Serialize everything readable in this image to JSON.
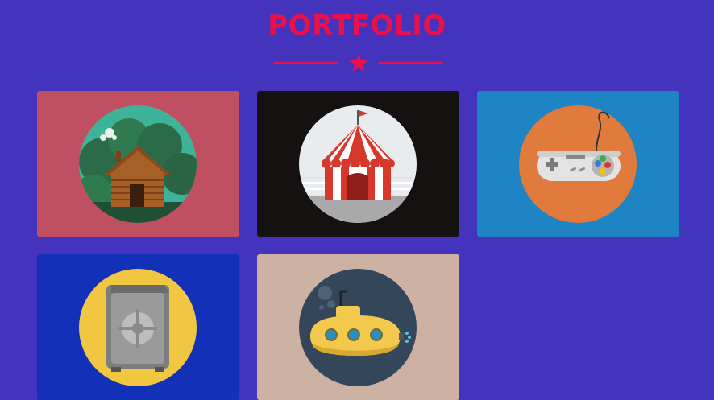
{
  "header": {
    "title": "PORTFOLIO"
  },
  "portfolio": {
    "items": [
      {
        "name": "log-cabin",
        "icon": "log-cabin-icon",
        "bg": "#c14f62"
      },
      {
        "name": "circus-tent",
        "icon": "circus-tent-icon",
        "bg": "#141110"
      },
      {
        "name": "game-controller",
        "icon": "game-controller-icon",
        "bg": "#1f84c4"
      },
      {
        "name": "safe",
        "icon": "safe-icon",
        "bg": "#1230b8"
      },
      {
        "name": "submarine",
        "icon": "submarine-icon",
        "bg": "#cdb2a3"
      }
    ]
  },
  "colors": {
    "page_bg": "#4333bd",
    "accent": "#e8104d"
  }
}
